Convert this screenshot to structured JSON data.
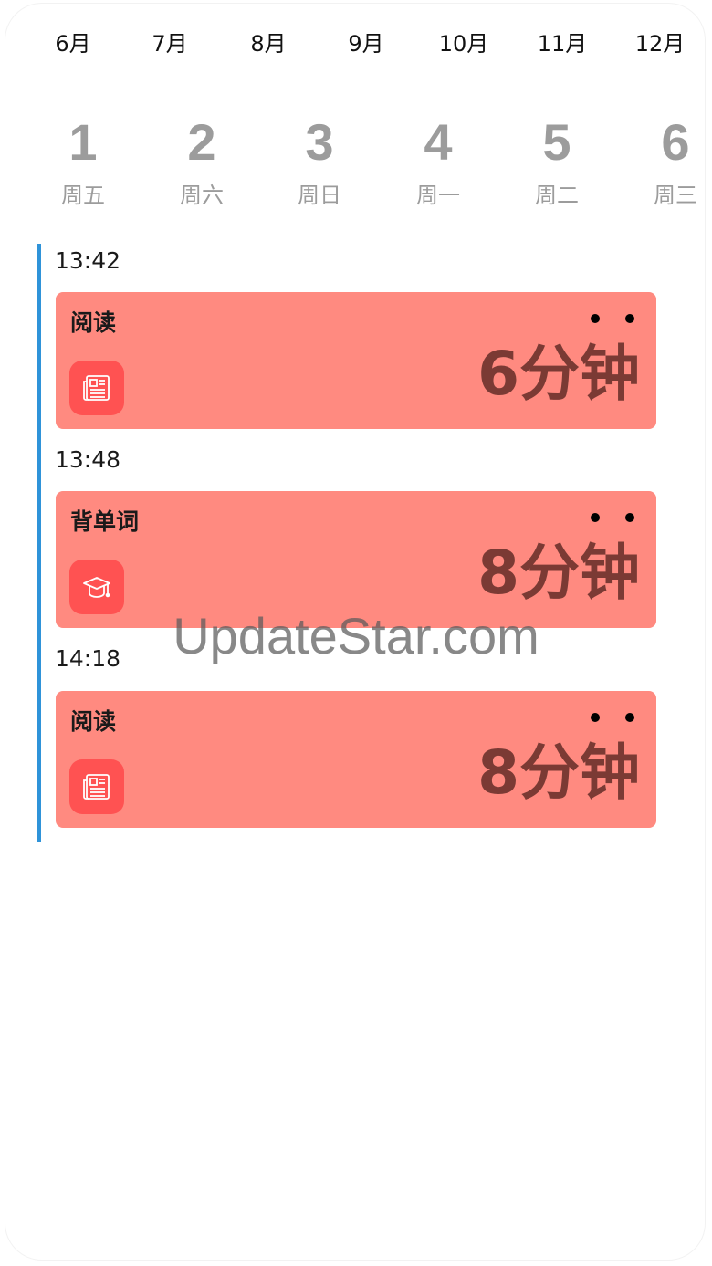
{
  "months": [
    "6月",
    "7月",
    "8月",
    "9月",
    "10月",
    "11月",
    "12月"
  ],
  "days": [
    {
      "num": "1",
      "weekday": "周五"
    },
    {
      "num": "2",
      "weekday": "周六"
    },
    {
      "num": "3",
      "weekday": "周日"
    },
    {
      "num": "4",
      "weekday": "周一"
    },
    {
      "num": "5",
      "weekday": "周二"
    },
    {
      "num": "6",
      "weekday": "周三"
    }
  ],
  "entries": [
    {
      "time": "13:42",
      "title": "阅读",
      "duration": "6分钟",
      "icon": "newspaper-icon"
    },
    {
      "time": "13:48",
      "title": "背单词",
      "duration": "8分钟",
      "icon": "graduation-cap-icon"
    },
    {
      "time": "14:18",
      "title": "阅读",
      "duration": "8分钟",
      "icon": "newspaper-icon"
    }
  ],
  "colors": {
    "timeline": "#2f93d9",
    "card": "#ff8a80",
    "icon_bg": "#ff5252",
    "duration_text": "#7b3a34",
    "day_text": "#9c9c9c"
  },
  "watermark": "UpdateStar.com"
}
